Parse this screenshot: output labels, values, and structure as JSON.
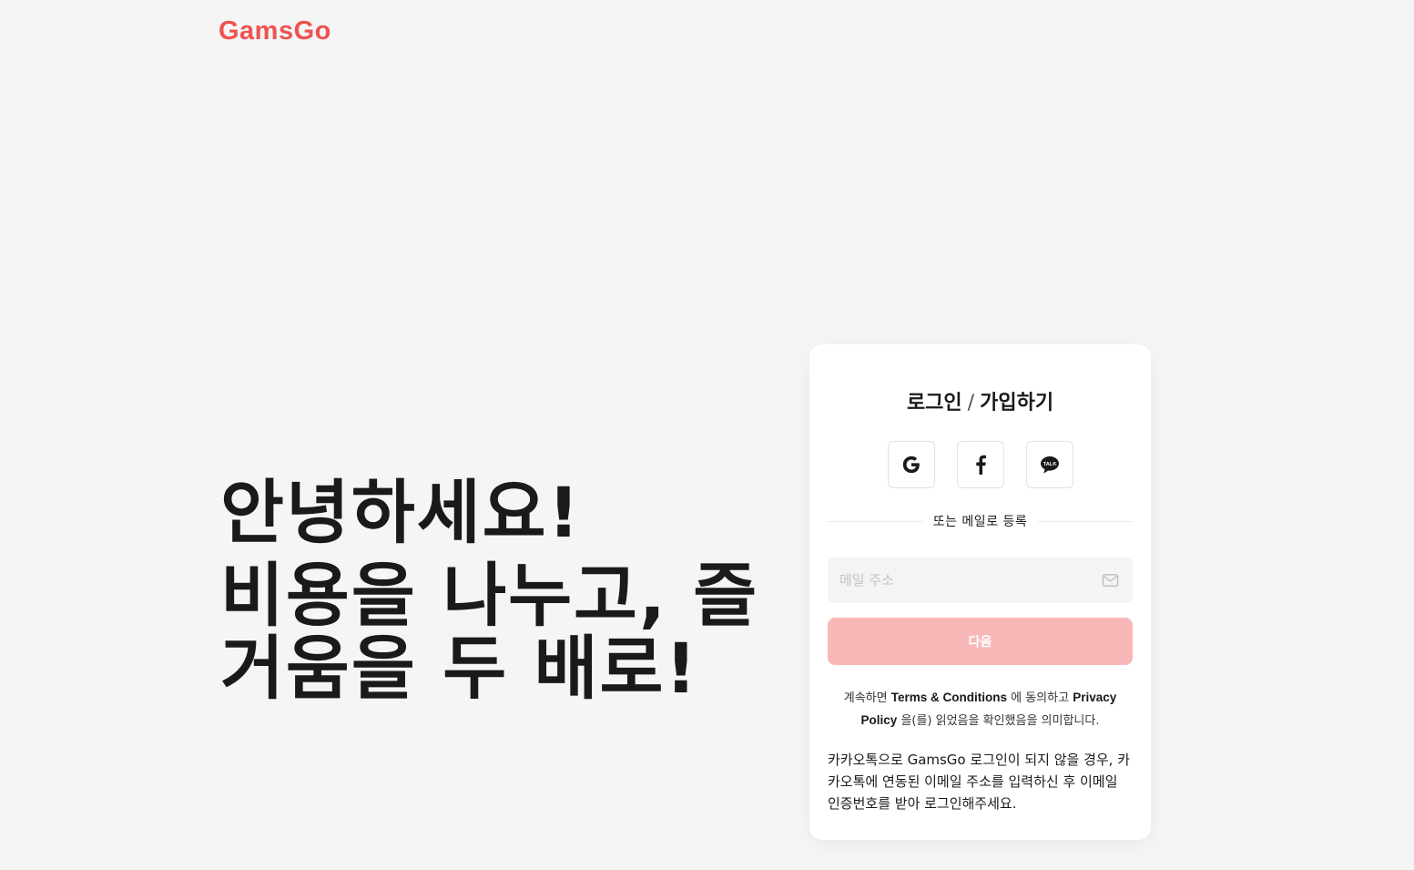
{
  "brand": {
    "logo_text": "GamsGo",
    "color": "#ef5350"
  },
  "hero": {
    "line1": "안녕하세요!",
    "line2": "비용을 나누고, 즐거움을 두 배로!"
  },
  "login_card": {
    "title_login": "로그인",
    "title_sep": "/",
    "title_signup": "가입하기",
    "social": [
      {
        "name": "google",
        "icon": "google-icon"
      },
      {
        "name": "facebook",
        "icon": "facebook-icon"
      },
      {
        "name": "kakaotalk",
        "icon": "kakaotalk-icon",
        "icon_text": "TALK"
      }
    ],
    "divider_text": "또는 메일로 등록",
    "email_placeholder": "메일 주소",
    "email_value": "",
    "next_label": "다음",
    "next_color": "#f9b8b8",
    "terms": {
      "prefix": "계속하면",
      "terms_link": "Terms & Conditions",
      "middle": "에 동의하고",
      "privacy_link": "Privacy Policy",
      "suffix": "을(를) 읽었음을 확인했음을 의미합니다."
    },
    "kakao_note": "카카오톡으로 GamsGo 로그인이 되지 않을 경우, 카카오톡에 연동된 이메일 주소를 입력하신 후 이메일 인증번호를 받아 로그인해주세요."
  }
}
